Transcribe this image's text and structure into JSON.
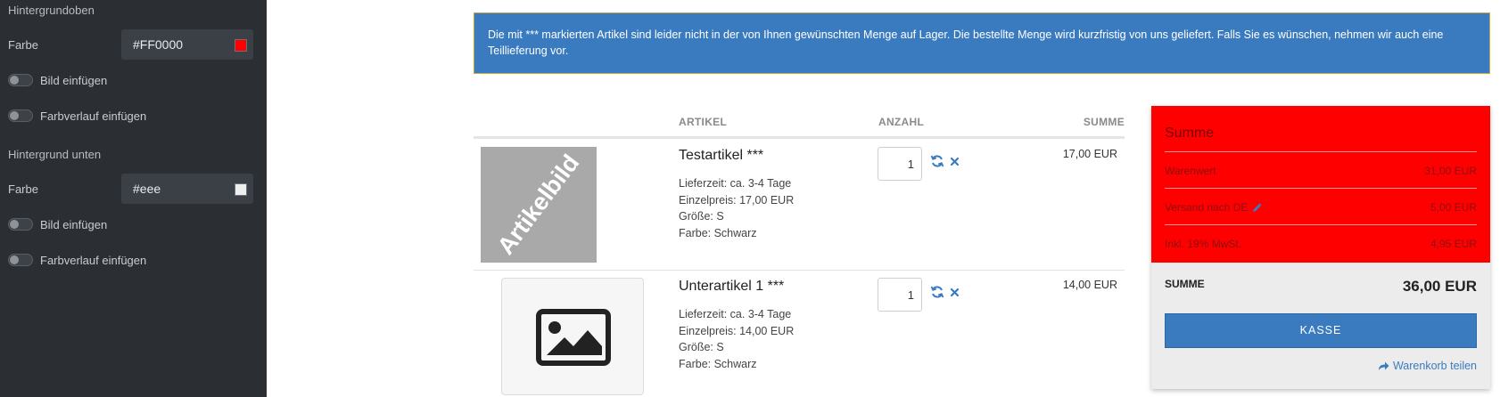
{
  "sidebar": {
    "top": {
      "heading": "Hintergrundoben",
      "color_label": "Farbe",
      "color_value": "#FF0000",
      "swatch": "#ff0000",
      "toggle_image": "Bild einfügen",
      "toggle_gradient": "Farbverlauf einfügen"
    },
    "bottom": {
      "heading": "Hintergrund unten",
      "color_label": "Farbe",
      "color_value": "#eee",
      "swatch": "#eeeeee",
      "toggle_image": "Bild einfügen",
      "toggle_gradient": "Farbverlauf einfügen"
    }
  },
  "alert": {
    "text": "Die mit *** markierten Artikel sind leider nicht in der von Ihnen gewünschten Menge auf Lager. Die bestellte Menge wird kurzfristig von uns geliefert. Falls Sie es wünschen, nehmen wir auch eine Teillieferung vor."
  },
  "table": {
    "headers": {
      "article": "ARTIKEL",
      "quantity": "ANZAHL",
      "sum": "SUMME"
    },
    "items": [
      {
        "thumb_text": "Artikelbild",
        "name": "Testartikel ***",
        "delivery": "Lieferzeit: ca. 3-4 Tage",
        "unit_price": "Einzelpreis: 17,00 EUR",
        "size": "Größe: S",
        "color": "Farbe: Schwarz",
        "qty": "1",
        "total": "17,00 EUR"
      },
      {
        "thumb_icon": "image-placeholder-icon",
        "name": "Unterartikel 1 ***",
        "delivery": "Lieferzeit: ca. 3-4 Tage",
        "unit_price": "Einzelpreis: 14,00 EUR",
        "size": "Größe: S",
        "color": "Farbe: Schwarz",
        "qty": "1",
        "total": "14,00 EUR"
      }
    ]
  },
  "summary": {
    "title": "Summe",
    "rows": [
      {
        "label": "Warenwert",
        "value": "31,00 EUR"
      },
      {
        "label": "Versand nach DE",
        "value": "5,00 EUR"
      },
      {
        "label": "Inkl. 19% MwSt.",
        "value": "4,95 EUR"
      }
    ],
    "total_label": "SUMME",
    "total_value": "36,00 EUR",
    "checkout": "KASSE",
    "share": "Warenkorb teilen"
  },
  "colors": {
    "accent": "#3a7bbf",
    "summary_top": "#ff0000",
    "summary_bottom": "#eeeeee"
  }
}
